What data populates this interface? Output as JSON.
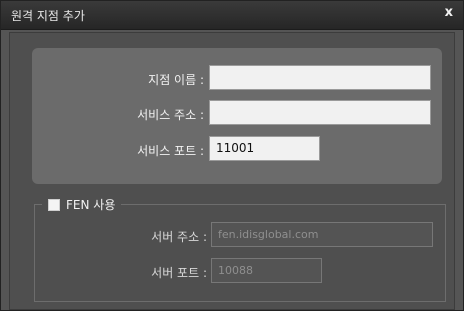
{
  "dialog": {
    "title": "원격 지점 추가",
    "close_glyph": "x"
  },
  "site": {
    "name_label": "지점 이름 :",
    "name_value": "",
    "service_address_label": "서비스 주소 :",
    "service_address_value": "",
    "service_port_label": "서비스 포트 :",
    "service_port_value": "11001"
  },
  "fen": {
    "checkbox_label": "FEN 사용",
    "checked": false,
    "server_address_label": "서버 주소 :",
    "server_address_value": "fen.idisglobal.com",
    "server_port_label": "서버 포트 :",
    "server_port_value": "10088"
  }
}
